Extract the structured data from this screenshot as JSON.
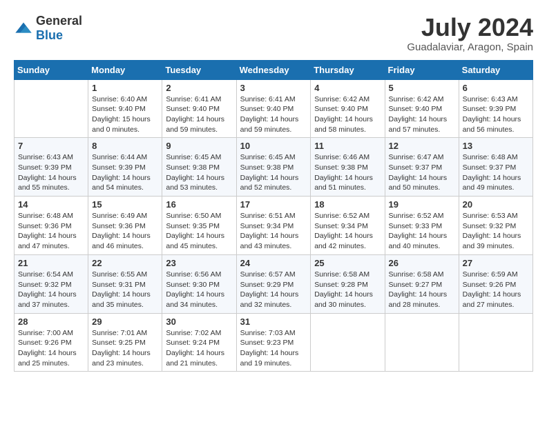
{
  "header": {
    "logo_general": "General",
    "logo_blue": "Blue",
    "month_year": "July 2024",
    "location": "Guadalaviar, Aragon, Spain"
  },
  "calendar": {
    "days_of_week": [
      "Sunday",
      "Monday",
      "Tuesday",
      "Wednesday",
      "Thursday",
      "Friday",
      "Saturday"
    ],
    "weeks": [
      [
        {
          "day": "",
          "info": ""
        },
        {
          "day": "1",
          "info": "Sunrise: 6:40 AM\nSunset: 9:40 PM\nDaylight: 15 hours\nand 0 minutes."
        },
        {
          "day": "2",
          "info": "Sunrise: 6:41 AM\nSunset: 9:40 PM\nDaylight: 14 hours\nand 59 minutes."
        },
        {
          "day": "3",
          "info": "Sunrise: 6:41 AM\nSunset: 9:40 PM\nDaylight: 14 hours\nand 59 minutes."
        },
        {
          "day": "4",
          "info": "Sunrise: 6:42 AM\nSunset: 9:40 PM\nDaylight: 14 hours\nand 58 minutes."
        },
        {
          "day": "5",
          "info": "Sunrise: 6:42 AM\nSunset: 9:40 PM\nDaylight: 14 hours\nand 57 minutes."
        },
        {
          "day": "6",
          "info": "Sunrise: 6:43 AM\nSunset: 9:39 PM\nDaylight: 14 hours\nand 56 minutes."
        }
      ],
      [
        {
          "day": "7",
          "info": "Sunrise: 6:43 AM\nSunset: 9:39 PM\nDaylight: 14 hours\nand 55 minutes."
        },
        {
          "day": "8",
          "info": "Sunrise: 6:44 AM\nSunset: 9:39 PM\nDaylight: 14 hours\nand 54 minutes."
        },
        {
          "day": "9",
          "info": "Sunrise: 6:45 AM\nSunset: 9:38 PM\nDaylight: 14 hours\nand 53 minutes."
        },
        {
          "day": "10",
          "info": "Sunrise: 6:45 AM\nSunset: 9:38 PM\nDaylight: 14 hours\nand 52 minutes."
        },
        {
          "day": "11",
          "info": "Sunrise: 6:46 AM\nSunset: 9:38 PM\nDaylight: 14 hours\nand 51 minutes."
        },
        {
          "day": "12",
          "info": "Sunrise: 6:47 AM\nSunset: 9:37 PM\nDaylight: 14 hours\nand 50 minutes."
        },
        {
          "day": "13",
          "info": "Sunrise: 6:48 AM\nSunset: 9:37 PM\nDaylight: 14 hours\nand 49 minutes."
        }
      ],
      [
        {
          "day": "14",
          "info": "Sunrise: 6:48 AM\nSunset: 9:36 PM\nDaylight: 14 hours\nand 47 minutes."
        },
        {
          "day": "15",
          "info": "Sunrise: 6:49 AM\nSunset: 9:36 PM\nDaylight: 14 hours\nand 46 minutes."
        },
        {
          "day": "16",
          "info": "Sunrise: 6:50 AM\nSunset: 9:35 PM\nDaylight: 14 hours\nand 45 minutes."
        },
        {
          "day": "17",
          "info": "Sunrise: 6:51 AM\nSunset: 9:34 PM\nDaylight: 14 hours\nand 43 minutes."
        },
        {
          "day": "18",
          "info": "Sunrise: 6:52 AM\nSunset: 9:34 PM\nDaylight: 14 hours\nand 42 minutes."
        },
        {
          "day": "19",
          "info": "Sunrise: 6:52 AM\nSunset: 9:33 PM\nDaylight: 14 hours\nand 40 minutes."
        },
        {
          "day": "20",
          "info": "Sunrise: 6:53 AM\nSunset: 9:32 PM\nDaylight: 14 hours\nand 39 minutes."
        }
      ],
      [
        {
          "day": "21",
          "info": "Sunrise: 6:54 AM\nSunset: 9:32 PM\nDaylight: 14 hours\nand 37 minutes."
        },
        {
          "day": "22",
          "info": "Sunrise: 6:55 AM\nSunset: 9:31 PM\nDaylight: 14 hours\nand 35 minutes."
        },
        {
          "day": "23",
          "info": "Sunrise: 6:56 AM\nSunset: 9:30 PM\nDaylight: 14 hours\nand 34 minutes."
        },
        {
          "day": "24",
          "info": "Sunrise: 6:57 AM\nSunset: 9:29 PM\nDaylight: 14 hours\nand 32 minutes."
        },
        {
          "day": "25",
          "info": "Sunrise: 6:58 AM\nSunset: 9:28 PM\nDaylight: 14 hours\nand 30 minutes."
        },
        {
          "day": "26",
          "info": "Sunrise: 6:58 AM\nSunset: 9:27 PM\nDaylight: 14 hours\nand 28 minutes."
        },
        {
          "day": "27",
          "info": "Sunrise: 6:59 AM\nSunset: 9:26 PM\nDaylight: 14 hours\nand 27 minutes."
        }
      ],
      [
        {
          "day": "28",
          "info": "Sunrise: 7:00 AM\nSunset: 9:26 PM\nDaylight: 14 hours\nand 25 minutes."
        },
        {
          "day": "29",
          "info": "Sunrise: 7:01 AM\nSunset: 9:25 PM\nDaylight: 14 hours\nand 23 minutes."
        },
        {
          "day": "30",
          "info": "Sunrise: 7:02 AM\nSunset: 9:24 PM\nDaylight: 14 hours\nand 21 minutes."
        },
        {
          "day": "31",
          "info": "Sunrise: 7:03 AM\nSunset: 9:23 PM\nDaylight: 14 hours\nand 19 minutes."
        },
        {
          "day": "",
          "info": ""
        },
        {
          "day": "",
          "info": ""
        },
        {
          "day": "",
          "info": ""
        }
      ]
    ]
  }
}
